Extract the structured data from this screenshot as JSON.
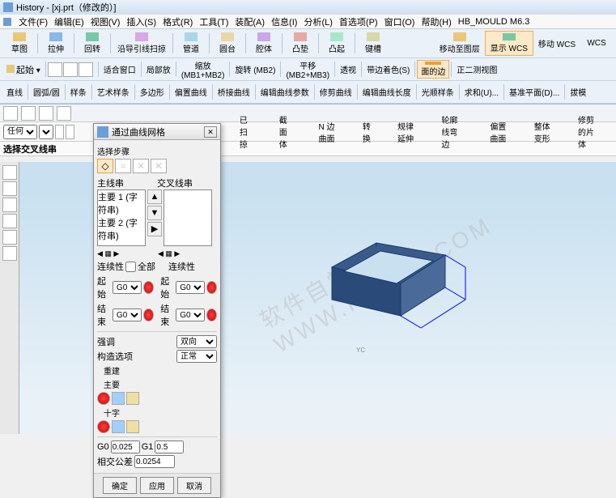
{
  "title": "History - [xj.prt（修改的）]",
  "menu": [
    "文件(F)",
    "编辑(E)",
    "视图(V)",
    "插入(S)",
    "格式(R)",
    "工具(T)",
    "装配(A)",
    "信息(I)",
    "分析(L)",
    "首选项(P)",
    "窗口(O)",
    "帮助(H)",
    "HB_MOULD M6.3"
  ],
  "ribbon1": [
    {
      "label": "草图",
      "icon": "ico-sketch"
    },
    {
      "label": "拉伸",
      "icon": "ico-extrude"
    },
    {
      "label": "回转",
      "icon": "ico-revolve"
    },
    {
      "label": "沿导引线扫掠",
      "icon": "ico-sweep"
    },
    {
      "label": "管道",
      "icon": "ico-pipe"
    },
    {
      "label": "圆台",
      "icon": "ico-cone"
    },
    {
      "label": "腔体",
      "icon": "ico-shell"
    },
    {
      "label": "凸垫",
      "icon": "ico-pad"
    },
    {
      "label": "凸起",
      "icon": "ico-rib"
    },
    {
      "label": "键槽",
      "icon": "ico-key"
    }
  ],
  "ribbon1_right": [
    {
      "label": "移动至图层"
    },
    {
      "label": "显示 WCS",
      "active": true
    },
    {
      "label": "移动 WCS"
    },
    {
      "label": "WCS"
    }
  ],
  "ribbon2": [
    {
      "label": "起始",
      "icon": ""
    },
    {
      "label": "",
      "icon": ""
    },
    {
      "label": "适合窗口"
    },
    {
      "label": "局部放"
    },
    {
      "label": "缩放",
      "sub": "(MB1+MB2)"
    },
    {
      "label": "旋转 (MB2)"
    },
    {
      "label": "平移",
      "sub": "(MB2+MB3)"
    },
    {
      "label": "透视"
    },
    {
      "label": "带边着色(S)"
    },
    {
      "label": "面的边",
      "active": true
    },
    {
      "label": "正二测视图"
    }
  ],
  "ribbon3": [
    {
      "label": "直线"
    },
    {
      "label": "圆弧/圆"
    },
    {
      "label": "样条"
    },
    {
      "label": "艺术样条"
    },
    {
      "label": "多边形"
    },
    {
      "label": "偏置曲线"
    },
    {
      "label": "桥接曲线"
    },
    {
      "label": "编辑曲线参数"
    },
    {
      "label": "修剪曲线"
    },
    {
      "label": "编辑曲线长度"
    },
    {
      "label": "光顺样条"
    },
    {
      "label": "求和(U)..."
    },
    {
      "label": "基准平面(D)..."
    },
    {
      "label": "拔模"
    }
  ],
  "tabs": [
    "已扫掠",
    "截面体",
    "N 边曲面",
    "转换",
    "规律延伸",
    "轮廓线弯边",
    "偏置曲面",
    "整体变形",
    "修剪的片体"
  ],
  "filter": {
    "value": "任何"
  },
  "selection_hint": "选择交叉线串",
  "dialog": {
    "title": "通过曲线网格",
    "step_label": "选择步骤",
    "primary_label": "主线串",
    "cross_label": "交叉线串",
    "primary_items": [
      "主要 1 (字符串)",
      "主要 2 (字符串)"
    ],
    "continuity_label": "连续性",
    "all_label": "全部",
    "start_label": "起始",
    "end_label": "结束",
    "g0": "G0",
    "emphasis": "强调",
    "bidir": "双向",
    "construct": "构造选项",
    "normal": "正常",
    "rebuild": "重建",
    "primary_sec": "主要",
    "cross_sec": "十字",
    "g0_val": "0.025",
    "g1": "G1",
    "g1_val": "0.5",
    "tol_label": "相交公差",
    "tol_val": "0.0254",
    "ok": "确定",
    "apply": "应用",
    "cancel": "取消"
  },
  "watermark": "软件自学网 WWW.RJZXW.COM"
}
